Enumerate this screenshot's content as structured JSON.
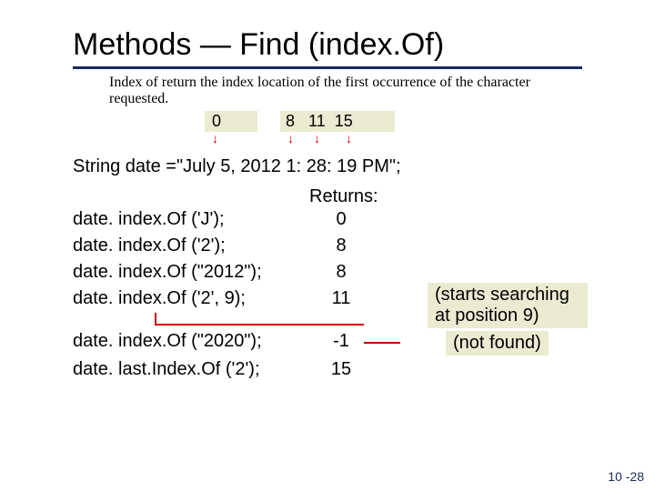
{
  "title": "Methods — Find (index.Of)",
  "description": "Index of return the index location of the first occurrence of the character requested.",
  "indices": {
    "i0": "0",
    "i1": "8",
    "i2": "11",
    "i3": "15"
  },
  "code": "String date =\"July 5, 2012 1: 28: 19 PM\";",
  "returns_label": "Returns:",
  "rows": [
    {
      "call": "date. index.Of ('J');",
      "result": "0"
    },
    {
      "call": "date. index.Of ('2');",
      "result": "8"
    },
    {
      "call": "date. index.Of (\"2012\");",
      "result": "8"
    },
    {
      "call": "date. index.Of ('2', 9);",
      "result": "11"
    },
    {
      "call": "date. index.Of (\"2020\");",
      "result": "-1"
    },
    {
      "call": "date. last.Index.Of ('2');",
      "result": "15"
    }
  ],
  "notes": {
    "starts": "(starts searching at position 9)",
    "notfound": "(not found)"
  },
  "footer": "10 -28"
}
